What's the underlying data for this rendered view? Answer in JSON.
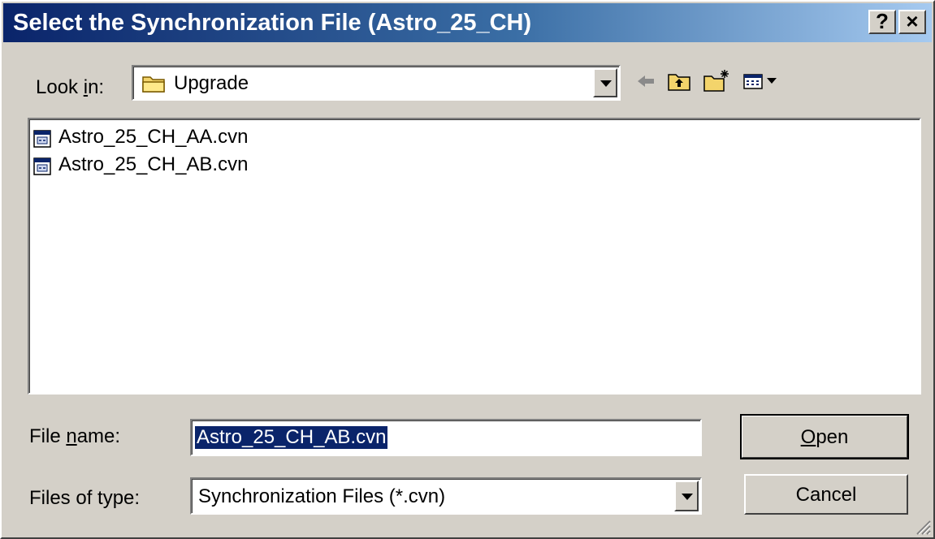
{
  "window": {
    "title": "Select the Synchronization File (Astro_25_CH)",
    "help_label": "?",
    "close_label": "×"
  },
  "look_in": {
    "label_pre": "Look ",
    "label_key": "i",
    "label_post": "n:",
    "value": "Upgrade",
    "icon": "folder-icon"
  },
  "toolbar": {
    "icons": [
      "back-arrow-icon",
      "up-one-level-icon",
      "create-new-folder-icon",
      "view-menu-icon"
    ]
  },
  "files": [
    {
      "name": "Astro_25_CH_AA.cvn",
      "icon": "cvn-file-icon"
    },
    {
      "name": "Astro_25_CH_AB.cvn",
      "icon": "cvn-file-icon"
    }
  ],
  "file_name": {
    "label_pre": "File ",
    "label_key": "n",
    "label_post": "ame:",
    "value": "Astro_25_CH_AB.cvn"
  },
  "file_type": {
    "label": "Files of type:",
    "value": "Synchronization Files (*.cvn)"
  },
  "buttons": {
    "open_key": "O",
    "open_rest": "pen",
    "cancel": "Cancel"
  },
  "colors": {
    "face": "#d4d0c8",
    "title_start": "#0a246a",
    "title_end": "#a6caf0",
    "selection": "#0a246a"
  }
}
